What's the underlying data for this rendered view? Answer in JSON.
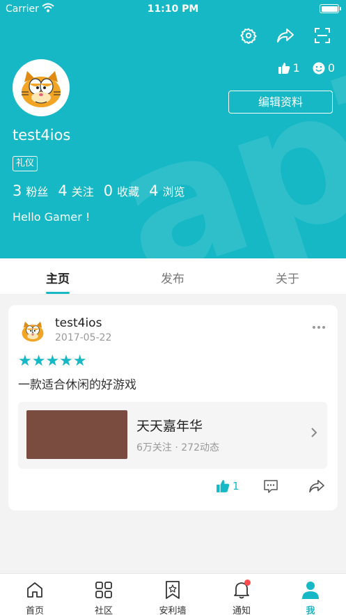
{
  "status_bar": {
    "carrier": "Carrier",
    "time": "11:10 PM",
    "battery_level": 1.0
  },
  "header": {
    "watermark": "apTap",
    "likes_count": "1",
    "smiles_count": "0",
    "edit_profile_label": "编辑资料",
    "username": "test4ios",
    "badge": "礼仪",
    "stats": [
      {
        "num": "3",
        "label": "粉丝"
      },
      {
        "num": "4",
        "label": "关注"
      },
      {
        "num": "0",
        "label": "收藏"
      },
      {
        "num": "4",
        "label": "浏览"
      }
    ],
    "bio": "Hello Gamer !"
  },
  "tabs": [
    {
      "label": "主页",
      "active": true
    },
    {
      "label": "发布",
      "active": false
    },
    {
      "label": "关于",
      "active": false
    }
  ],
  "post": {
    "author": "test4ios",
    "date": "2017-05-22",
    "rating": 5,
    "stars": "★★★★★",
    "text": "一款适合休闲的好游戏",
    "game": {
      "title": "天天嘉年华",
      "meta": "6万关注 · 272动态",
      "cover_color": "#7a4c40"
    },
    "like_count": "1"
  },
  "tabbar": [
    {
      "label": "首页",
      "icon": "home-icon"
    },
    {
      "label": "社区",
      "icon": "grid-icon"
    },
    {
      "label": "安利墙",
      "icon": "bookmark-star-icon"
    },
    {
      "label": "通知",
      "icon": "bell-icon",
      "has_dot": true
    },
    {
      "label": "我",
      "icon": "person-icon",
      "active": true
    }
  ],
  "colors": {
    "accent": "#17b8c6",
    "notification_dot": "#ff4d4f"
  }
}
